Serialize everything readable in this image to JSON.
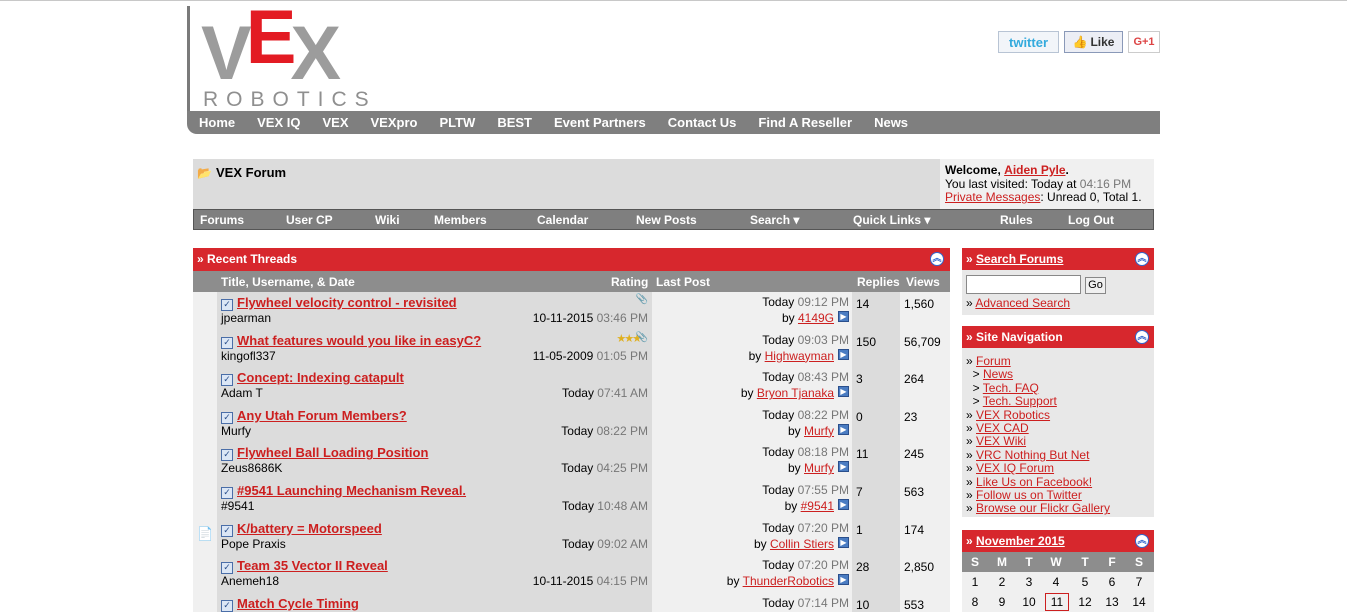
{
  "social": {
    "twitter": "twitter",
    "like": "Like",
    "gplus": "G+1"
  },
  "logo": {
    "vex_v": "V",
    "vex_e": "E",
    "vex_x": "X",
    "robotics": "ROBOTICS"
  },
  "main_nav": [
    "Home",
    "VEX IQ",
    "VEX",
    "VEXpro",
    "PLTW",
    "BEST",
    "Event Partners",
    "Contact Us",
    "Find A Reseller",
    "News"
  ],
  "forum": {
    "title": "VEX Forum"
  },
  "welcome": {
    "prefix": "Welcome,",
    "user": "Aiden Pyle",
    "suffix": ".",
    "last_visit_label": "You last visited: Today at",
    "last_visit_time": "04:16 PM",
    "pm_label": "Private Messages",
    "pm_status": ": Unread 0, Total 1."
  },
  "sub_nav": [
    "Forums",
    "User CP",
    "Wiki",
    "Members",
    "Calendar",
    "New Posts",
    "Search ▾",
    "Quick Links ▾",
    "Rules",
    "Log Out"
  ],
  "recent_threads": {
    "header": "» Recent Threads",
    "columns": {
      "title": "Title, Username, & Date",
      "rating": "Rating",
      "last_post": "Last Post",
      "replies": "Replies",
      "views": "Views"
    },
    "rows": [
      {
        "title": "Flywheel velocity control - revisited",
        "user": "jpearman",
        "date": "10-11-2015",
        "time": "03:46 PM",
        "last_date": "Today",
        "last_time": "09:12 PM",
        "by": "by",
        "last_user": "4149G",
        "replies": "14",
        "views": "1,560",
        "attach": true
      },
      {
        "title": "What features would you like in easyC?",
        "user": "kingofl337",
        "date": "11-05-2009",
        "time": "01:05 PM",
        "last_date": "Today",
        "last_time": "09:03 PM",
        "by": "by",
        "last_user": "Highwayman",
        "replies": "150",
        "views": "56,709",
        "stars": "★★★",
        "attach": true
      },
      {
        "title": "Concept: Indexing catapult",
        "user": "Adam T",
        "date": "Today",
        "time": "07:41 AM",
        "last_date": "Today",
        "last_time": "08:43 PM",
        "by": "by",
        "last_user": "Bryon Tjanaka",
        "replies": "3",
        "views": "264"
      },
      {
        "title": "Any Utah Forum Members?",
        "user": "Murfy",
        "date": "Today",
        "time": "08:22 PM",
        "last_date": "Today",
        "last_time": "08:22 PM",
        "by": "by",
        "last_user": "Murfy",
        "replies": "0",
        "views": "23"
      },
      {
        "title": "Flywheel Ball Loading Position",
        "user": "Zeus8686K",
        "date": "Today",
        "time": "04:25 PM",
        "last_date": "Today",
        "last_time": "08:18 PM",
        "by": "by",
        "last_user": "Murfy",
        "replies": "11",
        "views": "245"
      },
      {
        "title": "#9541 Launching Mechanism Reveal.",
        "user": "#9541",
        "date": "Today",
        "time": "10:48 AM",
        "last_date": "Today",
        "last_time": "07:55 PM",
        "by": "by",
        "last_user": "#9541",
        "replies": "7",
        "views": "563"
      },
      {
        "title": "K/battery = Motorspeed",
        "user": "Pope Praxis",
        "date": "Today",
        "time": "09:02 AM",
        "last_date": "Today",
        "last_time": "07:20 PM",
        "by": "by",
        "last_user": "Collin Stiers",
        "replies": "1",
        "views": "174",
        "note": true
      },
      {
        "title": "Team 35 Vector II Reveal",
        "user": "Anemeh18",
        "date": "10-11-2015",
        "time": "04:15 PM",
        "last_date": "Today",
        "last_time": "07:20 PM",
        "by": "by",
        "last_user": "ThunderRobotics",
        "replies": "28",
        "views": "2,850"
      },
      {
        "title": "Match Cycle Timing",
        "user": "",
        "date": "",
        "time": "",
        "last_date": "Today",
        "last_time": "07:14 PM",
        "by": "",
        "last_user": "",
        "replies": "10",
        "views": "553"
      }
    ]
  },
  "search_forums": {
    "header": "Search Forums",
    "go": "Go",
    "advanced": "Advanced Search"
  },
  "site_nav": {
    "header": "Site Navigation",
    "items": [
      {
        "prefix": "» ",
        "label": "Forum"
      },
      {
        "prefix": "  > ",
        "label": "News"
      },
      {
        "prefix": "  > ",
        "label": "Tech. FAQ"
      },
      {
        "prefix": "  > ",
        "label": "Tech. Support"
      },
      {
        "prefix": "» ",
        "label": "VEX Robotics"
      },
      {
        "prefix": "» ",
        "label": "VEX CAD"
      },
      {
        "prefix": "» ",
        "label": "VEX Wiki"
      },
      {
        "prefix": "» ",
        "label": "VRC Nothing But Net"
      },
      {
        "prefix": "» ",
        "label": "VEX IQ Forum"
      },
      {
        "prefix": "» ",
        "label": "Like Us on Facebook!"
      },
      {
        "prefix": "» ",
        "label": "Follow us on Twitter"
      },
      {
        "prefix": "» ",
        "label": "Browse our Flickr Gallery"
      }
    ]
  },
  "calendar": {
    "header": "November 2015",
    "days": [
      "S",
      "M",
      "T",
      "W",
      "T",
      "F",
      "S"
    ],
    "week1": [
      "1",
      "2",
      "3",
      "4",
      "5",
      "6",
      "7"
    ],
    "week2": [
      "8",
      "9",
      "10",
      "11",
      "12",
      "13",
      "14"
    ],
    "today": "11"
  }
}
